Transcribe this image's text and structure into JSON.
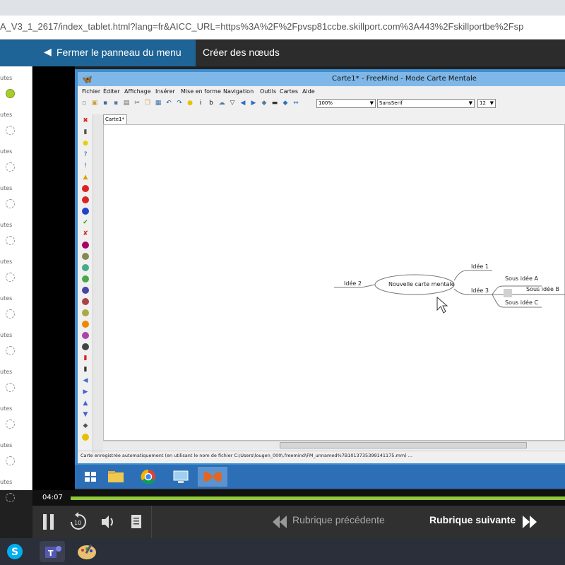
{
  "browser": {
    "address": "A_V3_1_2617/index_tablet.html?lang=fr&AICC_URL=https%3A%2F%2Fpvsp81ccbe.skillport.com%3A443%2Fskillportbe%2Fsp"
  },
  "course": {
    "close_menu_label": "Fermer le panneau du menu",
    "lesson_title": "Créer des nœuds"
  },
  "left_menu": {
    "items": [
      {
        "label": "utes",
        "status": "done"
      },
      {
        "label": "utes",
        "status": "pending"
      },
      {
        "label": "utes",
        "status": "pending"
      },
      {
        "label": "utes",
        "status": "pending"
      },
      {
        "label": "utes",
        "status": "pending"
      },
      {
        "label": "utes",
        "status": "pending"
      },
      {
        "label": "utes",
        "status": "pending"
      },
      {
        "label": "utes",
        "status": "pending"
      },
      {
        "label": "utes",
        "status": "pending"
      },
      {
        "label": "utes",
        "status": "pending"
      },
      {
        "label": "utes",
        "status": "pending"
      },
      {
        "label": "utes",
        "status": "pending"
      }
    ]
  },
  "freemind": {
    "window_title": "Carte1* - FreeMind - Mode Carte Mentale",
    "menu": [
      "Fichier",
      "Éditer",
      "Affichage",
      "Insérer",
      "Mise en forme",
      "Navigation",
      "Outils",
      "Cartes",
      "Aide"
    ],
    "zoom_value": "100%",
    "font_value": "SansSerif",
    "size_value": "12",
    "tab_label": "Carte1*",
    "status_text": "Carte enregistrée automatiquement (en utilisant le nom de fichier C:\\Users\\lougen_000\\.freemind\\FM_unnamed%7B1013735399141175.mm) ...",
    "nodes": {
      "root": "Nouvelle carte mentale",
      "idea1": "Idée 1",
      "idea2": "Idée 2",
      "idea3": "Idée 3",
      "sub_a": "Sous idée A",
      "sub_b": "Sous idée B",
      "sub_c": "Sous idée C"
    }
  },
  "player": {
    "time": "04:07",
    "progress": 1.0,
    "prev_label": "Rubrique précédente",
    "next_label": "Rubrique suivante"
  },
  "colors": {
    "header_blue": "#1e6496",
    "progress_green": "#91c83a",
    "freemind_blue": "#3e8ed0",
    "taskbar_blue": "#2d6fb6"
  }
}
